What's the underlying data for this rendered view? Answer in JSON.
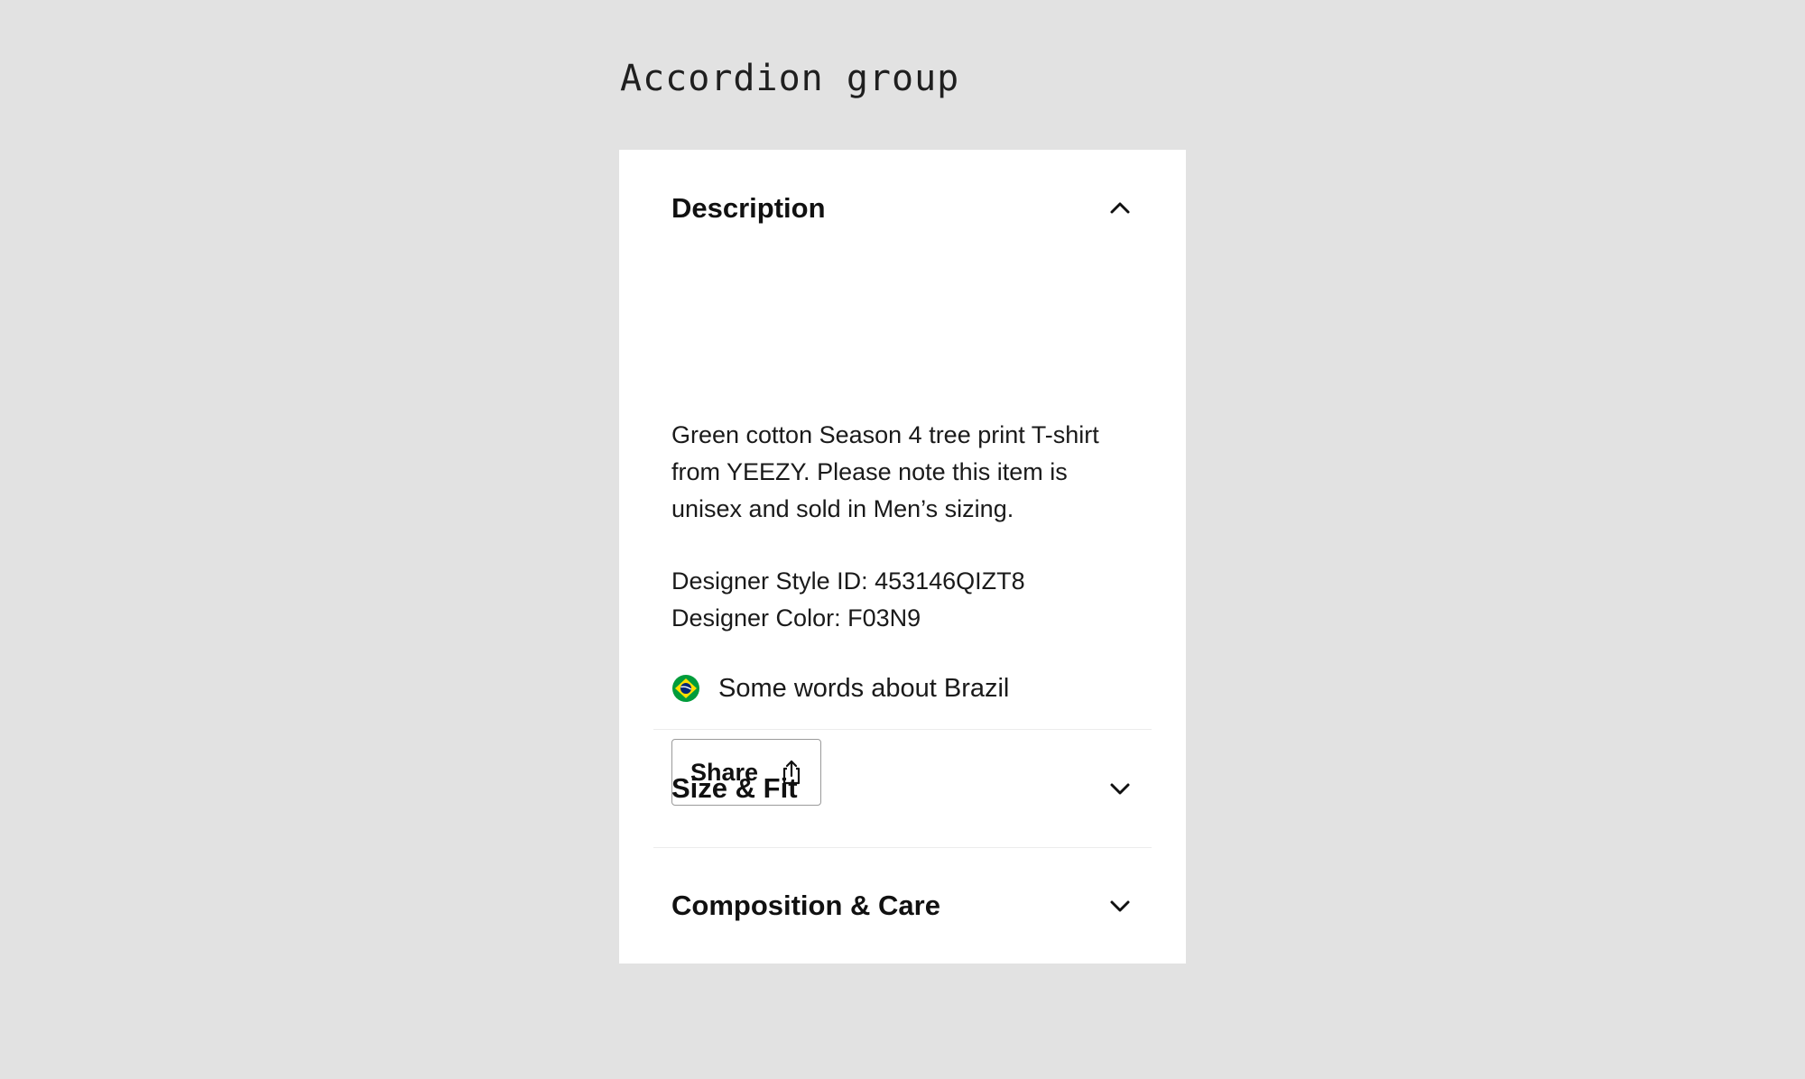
{
  "page": {
    "heading": "Accordion group"
  },
  "accordion": {
    "panels": [
      {
        "title": "Description",
        "expanded": true,
        "chevron_icon": "chevron-up-icon",
        "body": {
          "description": "Green cotton Season 4 tree print T-shirt from YEEZY. Please note this item is unisex and sold in Men’s sizing.",
          "style_id": "Designer Style ID: 453146QIZT8",
          "color": "Designer Color: F03N9",
          "flag_icon": "brazil-flag-icon",
          "flag_text": "Some words about Brazil",
          "share_label": "Share",
          "share_icon": "share-icon"
        }
      },
      {
        "title": "Size & Fit",
        "expanded": false,
        "chevron_icon": "chevron-down-icon"
      },
      {
        "title": "Composition & Care",
        "expanded": false,
        "chevron_icon": "chevron-down-icon"
      }
    ]
  },
  "colors": {
    "background": "#e2e2e2",
    "card": "#ffffff",
    "text": "#111111",
    "divider": "#ececec",
    "button_border": "#9a9a9a",
    "flag_green": "#009c3b",
    "flag_yellow": "#ffdf00",
    "flag_blue": "#002776"
  }
}
